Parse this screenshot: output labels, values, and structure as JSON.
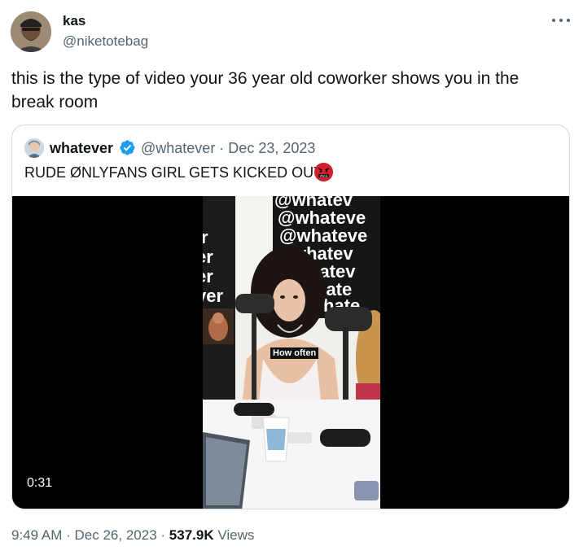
{
  "tweet": {
    "display_name": "kas",
    "handle": "@niketotebag",
    "text": "this is the type of video your 36 year old coworker shows you in the break room",
    "time": "9:49 AM",
    "separator": "·",
    "date": "Dec 26, 2023",
    "separator2": "·",
    "views_count": "537.9K",
    "views_label": "Views"
  },
  "quote": {
    "display_name": "whatever",
    "handle_and_date": "@whatever · Dec 23, 2023",
    "text": "RUDE ØNLYFANS GIRL GETS KICKED OUT",
    "video": {
      "duration": "0:31",
      "caption": "How often",
      "backdrop_text": "@whatever"
    }
  },
  "icons": {
    "more": "more-horizontal-icon",
    "verified": "verified-badge-icon",
    "emoji": "angry-face-emoji-icon"
  },
  "colors": {
    "text_primary": "#0f1419",
    "text_secondary": "#536471",
    "border": "#cfd9de",
    "verified_blue": "#1d9bf0",
    "video_bg": "#000000"
  }
}
